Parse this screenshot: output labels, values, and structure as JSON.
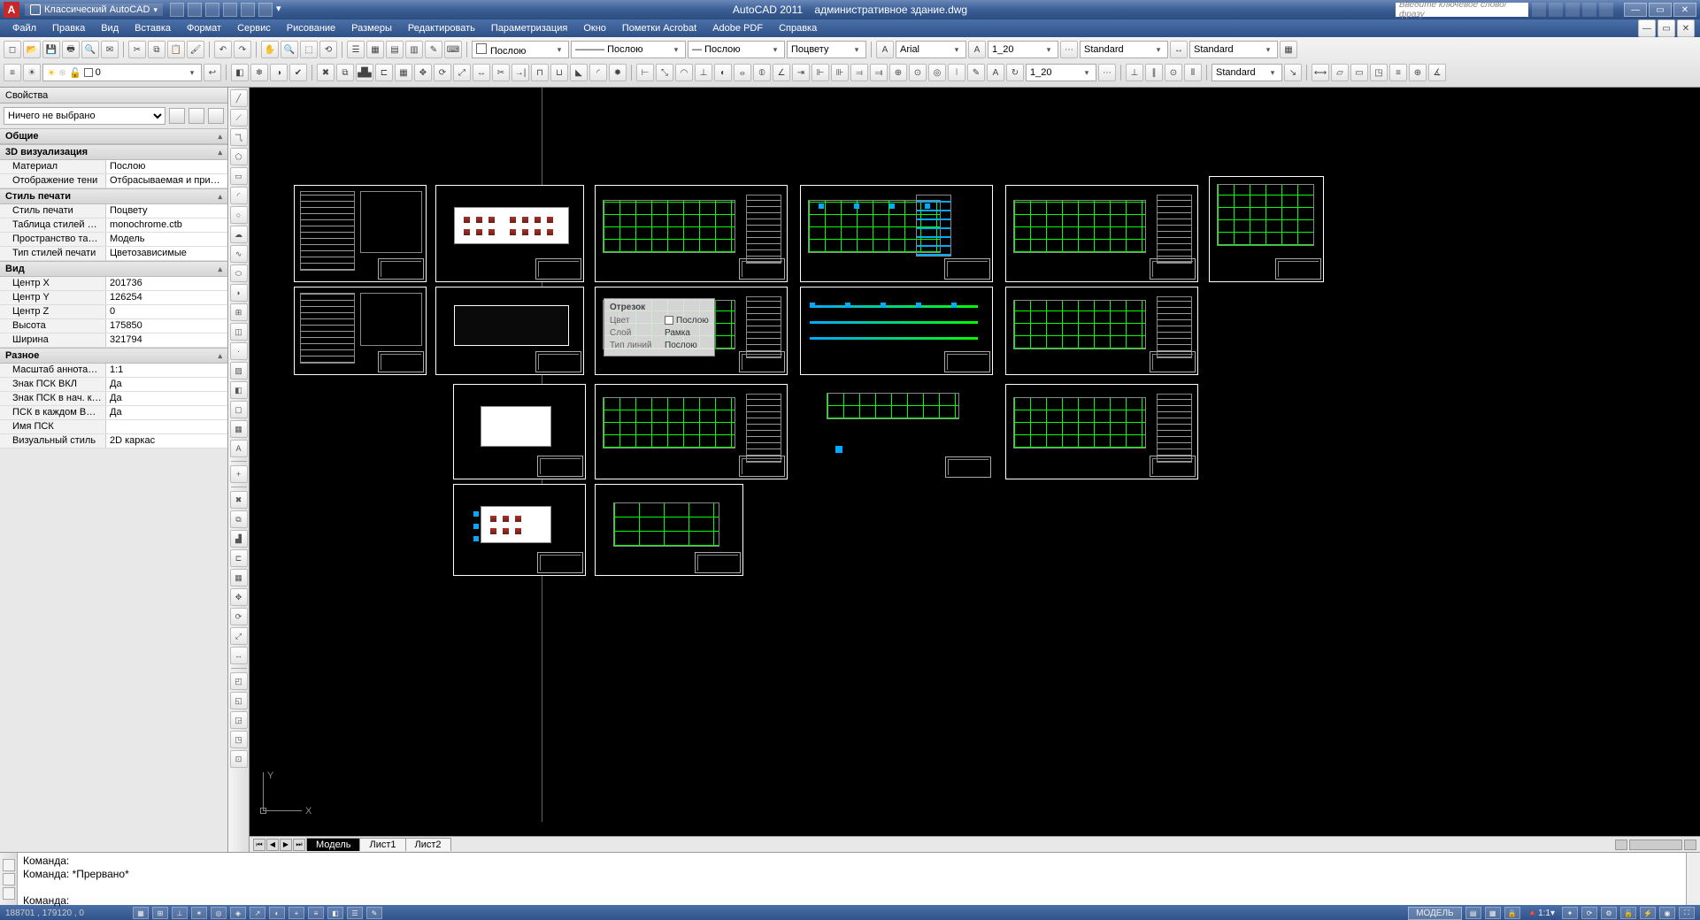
{
  "title": {
    "app": "AutoCAD 2011",
    "doc": "административное здание.dwg",
    "workspace": "Классический AutoCAD"
  },
  "search": {
    "placeholder": "Введите ключевое слово/фразу"
  },
  "menus": [
    "Файл",
    "Правка",
    "Вид",
    "Вставка",
    "Формат",
    "Сервис",
    "Рисование",
    "Размеры",
    "Редактировать",
    "Параметризация",
    "Окно",
    "Пометки Acrobat",
    "Adobe PDF",
    "Справка"
  ],
  "layer_combo": "0",
  "style_combos": {
    "color": "Послою",
    "linetype": "Послою",
    "lineweight": "Послою",
    "plotstyle": "Поцвету",
    "font": "Arial",
    "text_scale": "1_20",
    "text_style": "Standard",
    "dim_scale": "1_20",
    "dim_style": "Standard",
    "table_style": "Standard"
  },
  "properties": {
    "panel_title": "Свойства",
    "selection": "Ничего не выбрано",
    "groups": [
      {
        "name": "Общие",
        "rows": []
      },
      {
        "name": "3D визуализация",
        "rows": [
          {
            "k": "Материал",
            "v": "Послою"
          },
          {
            "k": "Отображение тени",
            "v": "Отбрасываемая и приним..."
          }
        ]
      },
      {
        "name": "Стиль печати",
        "rows": [
          {
            "k": "Стиль печати",
            "v": "Поцвету"
          },
          {
            "k": "Таблица стилей печа...",
            "v": "monochrome.ctb"
          },
          {
            "k": "Пространство табли...",
            "v": "Модель"
          },
          {
            "k": "Тип стилей печати",
            "v": "Цветозависимые"
          }
        ]
      },
      {
        "name": "Вид",
        "rows": [
          {
            "k": "Центр X",
            "v": "201736"
          },
          {
            "k": "Центр Y",
            "v": "126254"
          },
          {
            "k": "Центр Z",
            "v": "0"
          },
          {
            "k": "Высота",
            "v": "175850"
          },
          {
            "k": "Ширина",
            "v": "321794"
          }
        ]
      },
      {
        "name": "Разное",
        "rows": [
          {
            "k": "Масштаб аннотаций",
            "v": "1:1"
          },
          {
            "k": "Знак ПСК ВКЛ",
            "v": "Да"
          },
          {
            "k": "Знак ПСК в нач. коорд.",
            "v": "Да"
          },
          {
            "k": "ПСК в каждом ВЭкране",
            "v": "Да"
          },
          {
            "k": "Имя ПСК",
            "v": ""
          },
          {
            "k": "Визуальный стиль",
            "v": "2D каркас"
          }
        ]
      }
    ]
  },
  "tooltip": {
    "title": "Отрезок",
    "rows": [
      {
        "k": "Цвет",
        "v": "Послою"
      },
      {
        "k": "Слой",
        "v": "Рамка"
      },
      {
        "k": "Тип линий",
        "v": "Послою"
      }
    ]
  },
  "tabs": {
    "items": [
      "Модель",
      "Лист1",
      "Лист2"
    ],
    "active": 0
  },
  "command": {
    "lines": [
      "Команда:",
      "Команда: *Прервано*",
      "",
      "Команда:"
    ]
  },
  "status": {
    "coords": "188701 , 179120 , 0",
    "model": "МОДЕЛЬ",
    "annoscale": "1:1"
  },
  "ucs": {
    "x": "X",
    "y": "Y"
  }
}
